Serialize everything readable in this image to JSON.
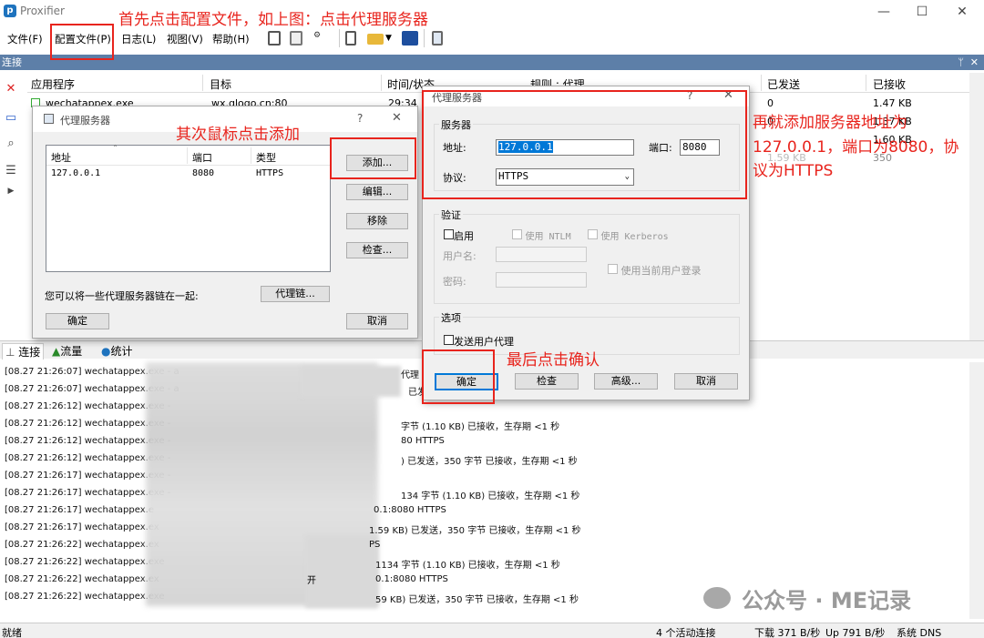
{
  "app": {
    "title": "Proxifier",
    "icon": "p"
  },
  "window_controls": {
    "min": "—",
    "max": "☐",
    "close": "✕"
  },
  "menu": [
    "文件(F)",
    "配置文件(P)",
    "日志(L)",
    "视图(V)",
    "帮助(H)"
  ],
  "connections_panel": {
    "title": "连接",
    "pin": "ᛘ",
    "close": "✕"
  },
  "table": {
    "headers": [
      "应用程序",
      "目标",
      "时间/状态",
      "规则 : 代理",
      "已发送",
      "已接收"
    ],
    "rows": [
      {
        "app": "wechatappex.exe",
        "target": "wx.qlogo.cn:80",
        "time": "29:34",
        "rule": "",
        "sent": "0",
        "recv": "1.47 KB"
      },
      {
        "app": "",
        "target": "",
        "time": "",
        "rule": "",
        "sent": "0",
        "recv": "1.37 KB"
      },
      {
        "app": "",
        "target": "",
        "time": "",
        "rule": "",
        "sent": "",
        "recv": "1.60 KB"
      },
      {
        "app": "",
        "target": "",
        "time": "",
        "rule": "",
        "sent": "",
        "recv": "350"
      }
    ],
    "partial_text": "1.59 KB"
  },
  "tabs": [
    "连接",
    "流量",
    "统计"
  ],
  "log": {
    "lines": [
      {
        "left": "[08.27 21:26:07] wechatappex.exe - a",
        "right": "代理 127.0.0.1:8080 HTTPS"
      },
      {
        "left": "[08.27 21:26:07] wechatappex.exe - a",
        "right": "已发"
      },
      {
        "left": "[08.27 21:26:12] wechatappex.exe -",
        "right": ""
      },
      {
        "left": "[08.27 21:26:12] wechatappex.exe -",
        "right": "字节 (1.10 KB) 已接收，生存期 <1 秒"
      },
      {
        "left": "[08.27 21:26:12] wechatappex.exe -",
        "right": "80 HTTPS"
      },
      {
        "left": "[08.27 21:26:12] wechatappex.exe -",
        "right": ") 已发送，350 字节 已接收，生存期 <1 秒"
      },
      {
        "left": "[08.27 21:26:17] wechatappex.exe -",
        "right": ""
      },
      {
        "left": "[08.27 21:26:17] wechatappex.exe -",
        "right": "134 字节 (1.10 KB) 已接收，生存期 <1 秒"
      },
      {
        "left": "[08.27 21:26:17] wechatappex.e",
        "right": "0.1:8080 HTTPS"
      },
      {
        "left": "[08.27 21:26:17] wechatappex.ex",
        "right": "1.59 KB) 已发送，350 字节 已接收，生存期 <1 秒"
      },
      {
        "left": "[08.27 21:26:22] wechatappex.ex",
        "right": "PS"
      },
      {
        "left": "[08.27 21:26:22] wechatappex.exe",
        "right": "1134 字节 (1.10 KB) 已接收，生存期 <1 秒"
      },
      {
        "left": "[08.27 21:26:22] wechatappex.ex",
        "right": "0.1:8080 HTTPS"
      },
      {
        "left": "[08.27 21:26:22] wechatappex.exe",
        "right": "59 KB) 已发送，350 字节 已接收，生存期 <1 秒"
      }
    ],
    "fragment": "开"
  },
  "status": {
    "left": "就绪",
    "active": "4 个活动连接",
    "down": "下载 371 B/秒",
    "up": "Up 791 B/秒",
    "dns": "系统 DNS"
  },
  "proxy_servers_dialog": {
    "title": "代理服务器",
    "help": "?",
    "close": "✕",
    "columns": [
      "地址",
      "端口",
      "类型"
    ],
    "sort_arrow": "ˆ",
    "rows": [
      {
        "address": "127.0.0.1",
        "port": "8080",
        "type": "HTTPS"
      }
    ],
    "buttons": {
      "add": "添加...",
      "edit": "编辑...",
      "remove": "移除",
      "check": "检查..."
    },
    "chain_text": "您可以将一些代理服务器链在一起:",
    "chain_button": "代理链...",
    "ok": "确定",
    "cancel": "取消"
  },
  "proxy_server_dialog": {
    "title": "代理服务器",
    "help": "?",
    "close": "✕",
    "server_group": "服务器",
    "address_label": "地址:",
    "address_value": "127.0.0.1",
    "port_label": "端口:",
    "port_value": "8080",
    "protocol_label": "协议:",
    "protocol_value": "HTTPS",
    "auth_group": "验证",
    "enable": "启用",
    "use_ntlm": "使用 NTLM",
    "use_kerberos": "使用 Kerberos",
    "username": "用户名:",
    "password": "密码:",
    "use_current_user": "使用当前用户登录",
    "options_group": "选项",
    "send_user_proxy": "发送用户代理",
    "ok": "确定",
    "check": "检查",
    "advanced": "高级...",
    "cancel": "取消"
  },
  "annotations": {
    "step1": "首先点击配置文件，如上图：点击代理服务器",
    "step2": "其次鼠标点击添加",
    "step3_line1": "再就添加服务器地址为",
    "step3_line2": "127.0.0.1，端口为8080，协",
    "step3_line3": "议为HTTPS",
    "step4": "最后点击确认",
    "watermark": "公众号 · ME记录"
  },
  "colors": {
    "annotation": "#e8241d",
    "header_bar": "#5d7fa8",
    "default_button": "#0078d7"
  }
}
